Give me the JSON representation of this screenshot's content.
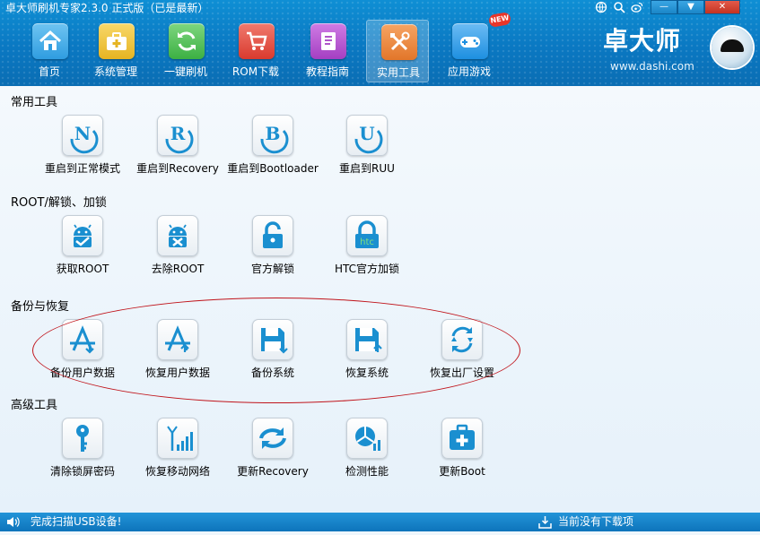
{
  "window": {
    "title": "卓大师刷机专家2.3.0 正式版（已是最新）",
    "minimize_glyph": "—",
    "menu_glyph": "▼",
    "close_glyph": "✕"
  },
  "nav": [
    {
      "label": "首页",
      "icon": "home-icon",
      "color": "#2f9de0"
    },
    {
      "label": "系统管理",
      "icon": "toolbox-icon",
      "color": "#e6b422"
    },
    {
      "label": "一键刷机",
      "icon": "refresh-icon",
      "color": "#3cb043"
    },
    {
      "label": "ROM下载",
      "icon": "cart-icon",
      "color": "#d93a2e"
    },
    {
      "label": "教程指南",
      "icon": "book-icon",
      "color": "#a43fc2"
    },
    {
      "label": "实用工具",
      "icon": "tools-icon",
      "color": "#e2762a",
      "active": true
    },
    {
      "label": "应用游戏",
      "icon": "gamepad-icon",
      "color": "#1d8fe0"
    }
  ],
  "new_badge": "NEW",
  "logo": {
    "name": "卓大师",
    "url": "www.dashi.com"
  },
  "sections": [
    {
      "title": "常用工具",
      "tools": [
        {
          "label": "重启到正常模式",
          "icon": "letter-n-icon",
          "glyph": "N"
        },
        {
          "label": "重启到Recovery",
          "icon": "letter-r-icon",
          "glyph": "R"
        },
        {
          "label": "重启到Bootloader",
          "icon": "letter-b-icon",
          "glyph": "B"
        },
        {
          "label": "重启到RUU",
          "icon": "letter-u-icon",
          "glyph": "U"
        }
      ]
    },
    {
      "title": "ROOT/解锁、加锁",
      "tools": [
        {
          "label": "获取ROOT",
          "icon": "android-check-icon"
        },
        {
          "label": "去除ROOT",
          "icon": "android-cross-icon"
        },
        {
          "label": "官方解锁",
          "icon": "unlock-icon"
        },
        {
          "label": "HTC官方加锁",
          "icon": "htc-lock-icon",
          "glyph": "htc"
        }
      ]
    },
    {
      "title": "备份与恢复",
      "tools": [
        {
          "label": "备份用户数据",
          "icon": "app-backup-icon"
        },
        {
          "label": "恢复用户数据",
          "icon": "app-restore-icon"
        },
        {
          "label": "备份系统",
          "icon": "floppy-backup-icon"
        },
        {
          "label": "恢复系统",
          "icon": "floppy-restore-icon"
        },
        {
          "label": "恢复出厂设置",
          "icon": "factory-reset-icon"
        }
      ]
    },
    {
      "title": "高级工具",
      "tools": [
        {
          "label": "清除锁屏密码",
          "icon": "key-icon"
        },
        {
          "label": "恢复移动网络",
          "icon": "signal-icon"
        },
        {
          "label": "更新Recovery",
          "icon": "update-arrows-icon"
        },
        {
          "label": "检测性能",
          "icon": "performance-chart-icon"
        },
        {
          "label": "更新Boot",
          "icon": "medkit-icon"
        }
      ]
    }
  ],
  "status": {
    "left": "完成扫描USB设备!",
    "right": "当前没有下载项"
  },
  "colors": {
    "accent": "#1784cc",
    "tool_blue": "#1a8fd0",
    "highlight": "#c0141b"
  }
}
